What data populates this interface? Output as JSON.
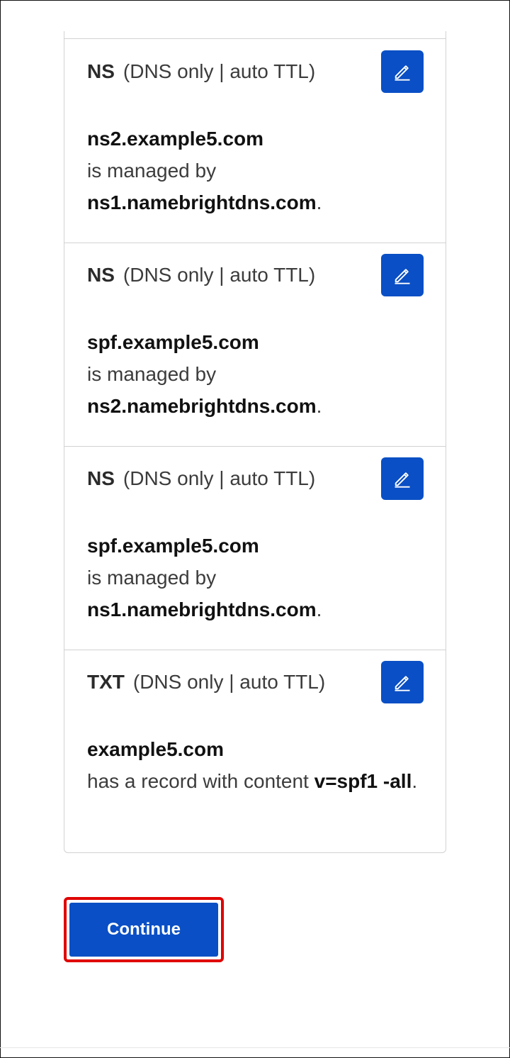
{
  "records": [
    {
      "type": "NS",
      "meta": "(DNS only | auto TTL)",
      "name": "ns2.example5.com",
      "relation": "is managed by",
      "target": "ns1.namebrightdns.com",
      "end": "."
    },
    {
      "type": "NS",
      "meta": "(DNS only | auto TTL)",
      "name": "spf.example5.com",
      "relation": "is managed by",
      "target": "ns2.namebrightdns.com",
      "end": "."
    },
    {
      "type": "NS",
      "meta": "(DNS only | auto TTL)",
      "name": "spf.example5.com",
      "relation": "is managed by",
      "target": "ns1.namebrightdns.com",
      "end": "."
    },
    {
      "type": "TXT",
      "meta": "(DNS only | auto TTL)",
      "name": "example5.com",
      "relation": "has a record with content",
      "target": "v=spf1 -all",
      "end": "."
    }
  ],
  "actions": {
    "continue_label": "Continue"
  },
  "icons": {
    "edit": "pencil-edit-icon"
  },
  "colors": {
    "primary": "#0a4fc5",
    "highlight": "#e00000"
  }
}
